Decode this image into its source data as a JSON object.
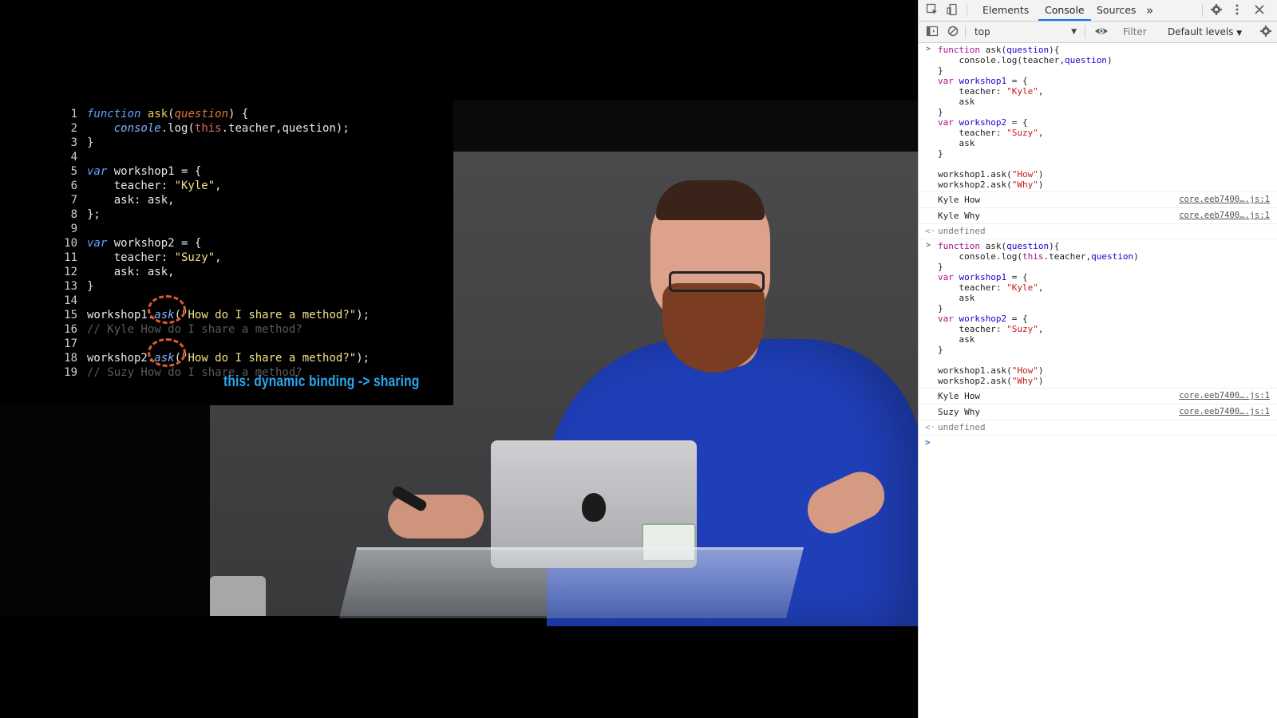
{
  "slide": {
    "lines": [
      {
        "n": "1",
        "html": "<span class='kw'>function</span> <span class='fn'>ask</span>(<span class='param'>question</span>) {"
      },
      {
        "n": "2",
        "html": "    <span class='obj'>console</span>.log(<span class='this'>this</span>.teacher,question);"
      },
      {
        "n": "3",
        "html": "}"
      },
      {
        "n": "4",
        "html": ""
      },
      {
        "n": "5",
        "html": "<span class='kw'>var</span> workshop1 = {"
      },
      {
        "n": "6",
        "html": "    teacher: <span class='str'>\"Kyle\"</span>,"
      },
      {
        "n": "7",
        "html": "    ask: ask,"
      },
      {
        "n": "8",
        "html": "};"
      },
      {
        "n": "9",
        "html": ""
      },
      {
        "n": "10",
        "html": "<span class='kw'>var</span> workshop2 = {"
      },
      {
        "n": "11",
        "html": "    teacher: <span class='str'>\"Suzy\"</span>,"
      },
      {
        "n": "12",
        "html": "    ask: ask,"
      },
      {
        "n": "13",
        "html": "}"
      },
      {
        "n": "14",
        "html": ""
      },
      {
        "n": "15",
        "html": "workshop1.<span class='obj'>ask</span>(<span class='str'>\"How do I share a method?\"</span>);"
      },
      {
        "n": "16",
        "html": "<span class='cmt'>// Kyle How do I share a method?</span>"
      },
      {
        "n": "17",
        "html": ""
      },
      {
        "n": "18",
        "html": "workshop2.<span class='obj'>ask</span>(<span class='str'>\"How do I share a method?\"</span>);"
      },
      {
        "n": "19",
        "html": "<span class='cmt'>// Suzy How do I share a method?</span>"
      }
    ],
    "caption": "this: dynamic binding -> sharing"
  },
  "devtools": {
    "tabs": [
      "Elements",
      "Console",
      "Sources"
    ],
    "active_tab": "Console",
    "more_tabs": "»",
    "context": "top",
    "filter_placeholder": "Filter",
    "levels": "Default levels",
    "blocks": [
      {
        "lines": [
          "<span class='k'>function</span> ask(<span class='p'>question</span>){",
          "    console.log(teacher,<span class='p'>question</span>)",
          "}",
          "<span class='k'>var</span> <span class='p'>workshop1</span> = {",
          "    teacher: <span class='s'>\"Kyle\"</span>,",
          "    ask",
          "}",
          "<span class='k'>var</span> <span class='p'>workshop2</span> = {",
          "    teacher: <span class='s'>\"Suzy\"</span>,",
          "    ask",
          "}",
          "",
          "workshop1.ask(<span class='s'>\"How\"</span>)",
          "workshop2.ask(<span class='s'>\"Why\"</span>)"
        ],
        "logs": [
          {
            "text": "Kyle How",
            "src": "core.eeb7400….js:1"
          },
          {
            "text": "Kyle Why",
            "src": "core.eeb7400….js:1"
          }
        ],
        "result": "undefined"
      },
      {
        "lines": [
          "<span class='k'>function</span> ask(<span class='p'>question</span>){",
          "    console.log(<span class='k'>this</span>.teacher,<span class='p'>question</span>)",
          "}",
          "<span class='k'>var</span> <span class='p'>workshop1</span> = {",
          "    teacher: <span class='s'>\"Kyle\"</span>,",
          "    ask",
          "}",
          "<span class='k'>var</span> <span class='p'>workshop2</span> = {",
          "    teacher: <span class='s'>\"Suzy\"</span>,",
          "    ask",
          "}",
          "",
          "workshop1.ask(<span class='s'>\"How\"</span>)",
          "workshop2.ask(<span class='s'>\"Why\"</span>)"
        ],
        "logs": [
          {
            "text": "Kyle How",
            "src": "core.eeb7400….js:1"
          },
          {
            "text": "Suzy Why",
            "src": "core.eeb7400….js:1"
          }
        ],
        "result": "undefined"
      }
    ],
    "icons": {
      "inspect": "inspect-element-icon",
      "device": "device-toolbar-icon",
      "settings": "gear-icon",
      "menu": "kebab-menu-icon",
      "close": "close-icon",
      "sidebar": "console-sidebar-icon",
      "clear": "clear-console-icon",
      "eye": "live-expression-icon",
      "console_settings": "console-settings-icon"
    },
    "accent_color": "#1a73e8"
  }
}
